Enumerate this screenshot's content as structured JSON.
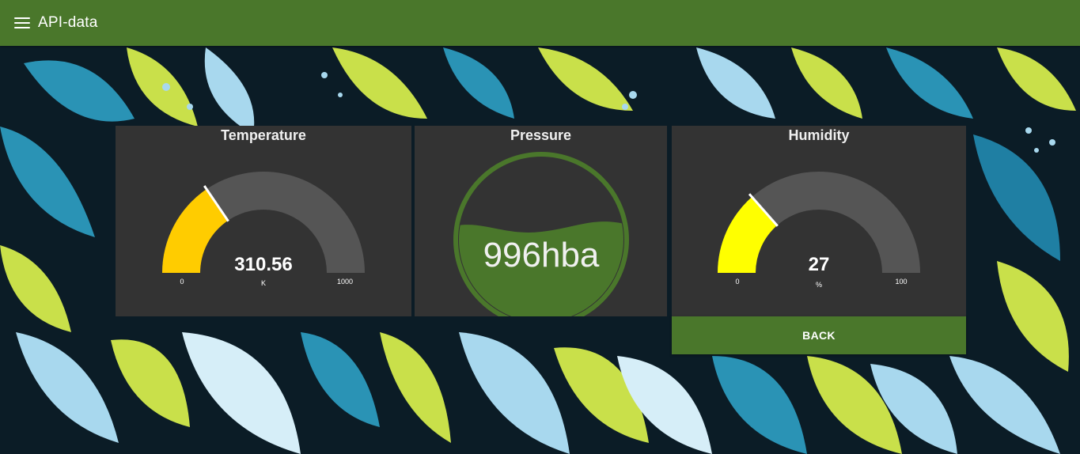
{
  "app": {
    "title": "API-data"
  },
  "temperature": {
    "title": "Temperature",
    "value": "310.56",
    "unit": "K",
    "min": "0",
    "max": "1000",
    "fraction": 0.31,
    "color": "#ffcc00"
  },
  "pressure": {
    "title": "Pressure",
    "value": "996hba",
    "color": "#4a772b"
  },
  "humidity": {
    "title": "Humidity",
    "value": "27",
    "unit": "%",
    "min": "0",
    "max": "100",
    "fraction": 0.27,
    "color": "#ffff00"
  },
  "back_button": {
    "label": "BACK"
  },
  "colors": {
    "header": "#4a772b",
    "card": "#333333",
    "track": "#555555"
  }
}
